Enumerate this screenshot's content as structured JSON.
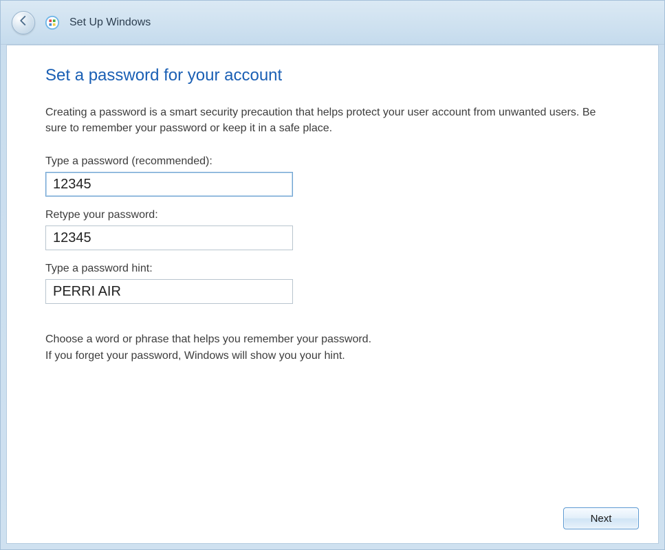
{
  "titlebar": {
    "title": "Set Up Windows"
  },
  "main": {
    "heading": "Set a password for your account",
    "description": "Creating a password is a smart security precaution that helps protect your user account from unwanted users. Be sure to remember your password or keep it in a safe place.",
    "fields": {
      "password": {
        "label": "Type a password (recommended):",
        "value": "12345"
      },
      "retype": {
        "label": "Retype your password:",
        "value": "12345"
      },
      "hint": {
        "label": "Type a password hint:",
        "value": "PERRI AIR"
      }
    },
    "hint_help_line1": "Choose a word or phrase that helps you remember your password.",
    "hint_help_line2": "If you forget your password, Windows will show you your hint."
  },
  "footer": {
    "next_label": "Next"
  }
}
